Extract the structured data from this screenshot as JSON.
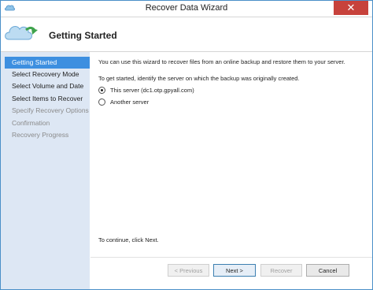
{
  "window": {
    "title": "Recover Data Wizard",
    "close_glyph": "✕"
  },
  "header": {
    "title": "Getting Started",
    "icon": "cloud-recover-icon"
  },
  "sidebar": {
    "items": [
      {
        "label": "Getting Started",
        "state": "active"
      },
      {
        "label": "Select Recovery Mode",
        "state": "normal"
      },
      {
        "label": "Select Volume and Date",
        "state": "normal"
      },
      {
        "label": "Select Items to Recover",
        "state": "normal"
      },
      {
        "label": "Specify Recovery Options",
        "state": "disabled"
      },
      {
        "label": "Confirmation",
        "state": "disabled"
      },
      {
        "label": "Recovery Progress",
        "state": "disabled"
      }
    ]
  },
  "content": {
    "intro": "You can use this wizard to recover files from an online backup and restore them to your server.",
    "prompt": "To get started, identify the server on which the backup was originally created.",
    "options": [
      {
        "label": "This server (dc1.otp.gpyall.com)",
        "selected": true
      },
      {
        "label": "Another server",
        "selected": false
      }
    ],
    "continue_hint": "To continue, click Next."
  },
  "footer": {
    "previous_label": "< Previous",
    "next_label": "Next >",
    "recover_label": "Recover",
    "cancel_label": "Cancel"
  },
  "colors": {
    "accent": "#3d8fe0",
    "sidebar_bg": "#dde7f4",
    "close_red": "#c7423c"
  }
}
